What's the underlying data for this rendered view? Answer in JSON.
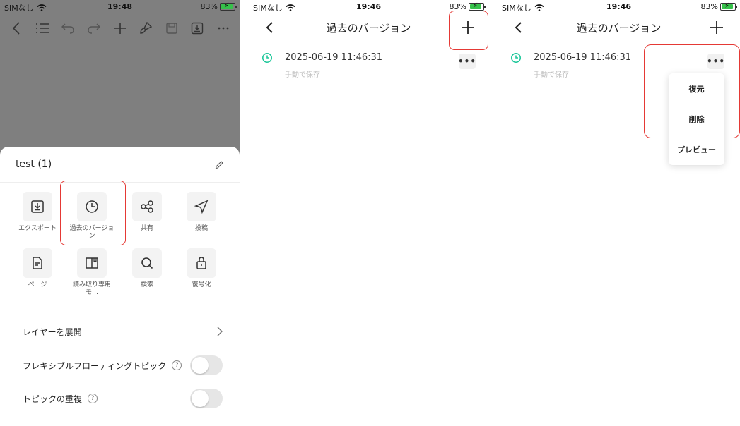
{
  "status": {
    "carrier": "SIMなし",
    "battery": "83%",
    "times": [
      "19:48",
      "19:46",
      "19:46"
    ]
  },
  "panel1": {
    "sheet_title": "test (1)",
    "grid": [
      {
        "label": "エクスポート",
        "icon": "export-icon"
      },
      {
        "label": "過去のバージョン",
        "icon": "clock-icon"
      },
      {
        "label": "共有",
        "icon": "share-icon"
      },
      {
        "label": "投稿",
        "icon": "send-icon"
      },
      {
        "label": "ページ",
        "icon": "page-icon"
      },
      {
        "label": "読み取り専用モ…",
        "icon": "book-icon"
      },
      {
        "label": "検索",
        "icon": "search-icon"
      },
      {
        "label": "復号化",
        "icon": "lock-icon"
      }
    ],
    "rows": {
      "expand_layers": "レイヤーを展開",
      "flexible_floating": "フレキシブルフローティングトピック",
      "duplicate_topic": "トピックの重複",
      "help": "?"
    }
  },
  "versions": {
    "title": "過去のバージョン",
    "entry": {
      "timestamp": "2025-06-19 11:46:31",
      "note": "手動で保存",
      "more": "•••"
    },
    "menu": [
      "復元",
      "削除",
      "プレビュー"
    ]
  },
  "colors": {
    "accent_green": "#1ec79a",
    "highlight_red": "#e53935",
    "overlay_gray": "#7f7f7f"
  }
}
